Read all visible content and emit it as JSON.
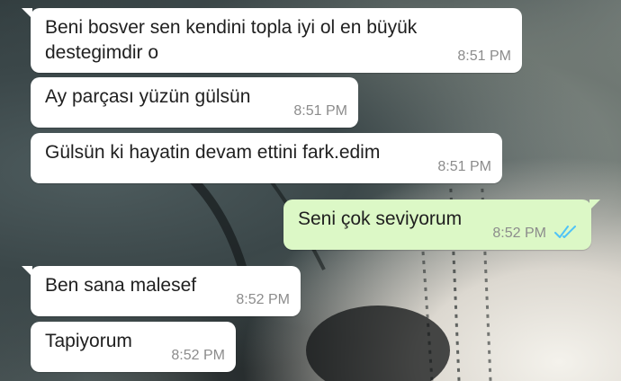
{
  "conversation": {
    "messages": [
      {
        "direction": "incoming",
        "text": "Beni bosver sen kendini topla iyi ol en büyük\ndestegimdir o",
        "time": "8:51 PM"
      },
      {
        "direction": "incoming",
        "text": "Ay parçası yüzün gülsün",
        "time": "8:51 PM"
      },
      {
        "direction": "incoming",
        "text": "Gülsün ki hayatin devam ettini fark.edim",
        "time": "8:51 PM"
      },
      {
        "direction": "outgoing",
        "text": "Seni çok seviyorum",
        "time": "8:52 PM",
        "status": "read"
      },
      {
        "direction": "incoming",
        "text": "Ben sana malesef",
        "time": "8:52 PM"
      },
      {
        "direction": "incoming",
        "text": "Tapiyorum",
        "time": "8:52 PM"
      }
    ]
  },
  "colors": {
    "incoming_bubble": "#ffffff",
    "outgoing_bubble": "#dcf8c6",
    "read_ticks": "#4fc3f7",
    "timestamp": "#8c8c8c"
  },
  "icons": {
    "read_status": "double-check-icon"
  }
}
